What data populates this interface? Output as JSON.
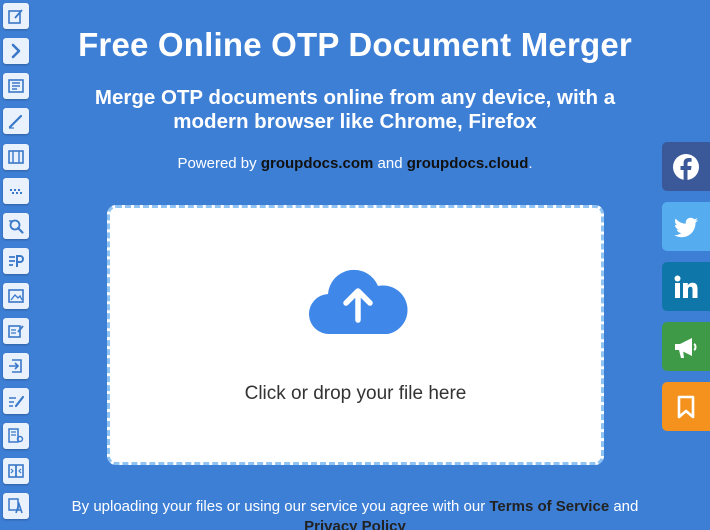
{
  "header": {
    "title": "Free Online OTP Document Merger",
    "subtitle": "Merge OTP documents online from any device, with a modern browser like Chrome, Firefox",
    "powered_prefix": "Powered by ",
    "powered_link1": "groupdocs.com",
    "powered_and": " and ",
    "powered_link2": "groupdocs.cloud",
    "powered_suffix": "."
  },
  "upload": {
    "prompt": "Click or drop your file here",
    "icon": "cloud-upload-icon"
  },
  "legal": {
    "prefix": "By uploading your files or using our service you agree with our ",
    "terms_label": "Terms of Service",
    "and": " and ",
    "privacy_label": "Privacy Policy"
  },
  "tool_rail": {
    "icons": [
      "edit-document-icon",
      "chevron-right-icon",
      "document-list-icon",
      "signature-pen-icon",
      "film-document-icon",
      "dots-grid-icon",
      "search-document-icon",
      "parser-icon",
      "image-frame-icon",
      "form-edit-icon",
      "exit-document-icon",
      "annotate-pen-icon",
      "compare-document-icon",
      "split-document-icon",
      "translate-icon"
    ]
  },
  "share": {
    "buttons": [
      {
        "name": "facebook-icon",
        "color": "#3b5998"
      },
      {
        "name": "twitter-icon",
        "color": "#55acee"
      },
      {
        "name": "linkedin-icon",
        "color": "#0e76a8"
      },
      {
        "name": "megaphone-icon",
        "color": "#3f9a47"
      },
      {
        "name": "bookmark-icon",
        "color": "#f5921e"
      }
    ]
  },
  "colors": {
    "background": "#3e7fd6",
    "cloud": "#3f87e8",
    "dropzone_border": "#8fc3f3"
  }
}
